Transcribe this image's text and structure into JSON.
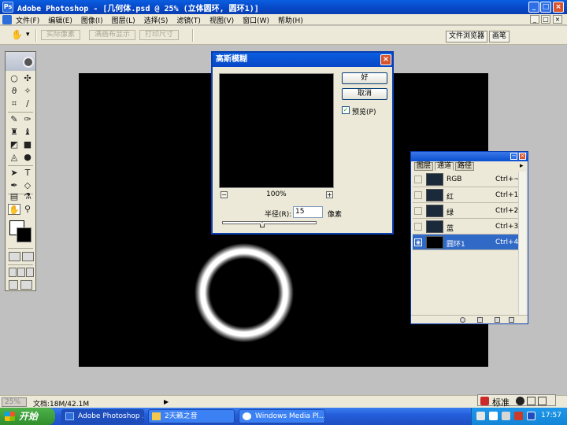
{
  "titlebar": {
    "title": "Adobe Photoshop - [几何体.psd @ 25% (立体圆环, 圆环1)]",
    "minimize": "_",
    "maximize": "□",
    "close": "×"
  },
  "menu": {
    "items": [
      "文件(F)",
      "编辑(E)",
      "图像(I)",
      "图层(L)",
      "选择(S)",
      "滤镜(T)",
      "视图(V)",
      "窗口(W)",
      "帮助(H)"
    ],
    "doc_minimize": "_",
    "doc_restore": "□",
    "doc_close": "×"
  },
  "options": {
    "hand_tool_icon": "✋",
    "dropdown_arrow": "▾",
    "actual_pixels": "实际像素",
    "fit_on_screen": "满画布显示",
    "print_size": "打印尺寸",
    "file_browser": "文件浏览器",
    "brushes": "画笔"
  },
  "toolbox": {
    "tools": [
      "○",
      "✣",
      "ϑ",
      "✧",
      "⌗",
      "∕",
      "✎",
      "✑",
      "♜",
      "♝",
      "◩",
      "■",
      "◬",
      "●",
      "➤",
      "T",
      "✒",
      "◇",
      "▤",
      "⚗",
      "✋",
      "⚲"
    ]
  },
  "dialog": {
    "title": "高斯模糊",
    "close": "×",
    "ok": "好",
    "cancel": "取消",
    "preview_checked": "✓",
    "preview_label": "预览(P)",
    "zoom_out": "−",
    "zoom_in": "+",
    "zoom": "100%",
    "radius_label": "半径(R):",
    "radius_value": "15",
    "unit": "像素"
  },
  "panel": {
    "tabs": [
      "图层",
      "通道",
      "路径"
    ],
    "min": "−",
    "close": "×",
    "menu_arrow": "▸",
    "eye": "◉",
    "channels": [
      {
        "name": "RGB",
        "shortcut": "Ctrl+~"
      },
      {
        "name": "红",
        "shortcut": "Ctrl+1"
      },
      {
        "name": "绿",
        "shortcut": "Ctrl+2"
      },
      {
        "name": "蓝",
        "shortcut": "Ctrl+3"
      },
      {
        "name": "圆环1",
        "shortcut": "Ctrl+4"
      }
    ]
  },
  "status": {
    "zoom": "25%",
    "doc_info": "文档:18M/42.1M",
    "arrow": "▶",
    "ime_mode": "标准"
  },
  "taskbar": {
    "start": "开始",
    "tasks": [
      "Adobe Photoshop ...",
      "2天籁之音",
      "Windows Media Pl..."
    ],
    "clock": "17:57"
  },
  "colors": {
    "title_blue": "#0747c6",
    "selected_row": "#3169c6",
    "start_green": "#2f8f2c",
    "chrome": "#ece9d8"
  }
}
